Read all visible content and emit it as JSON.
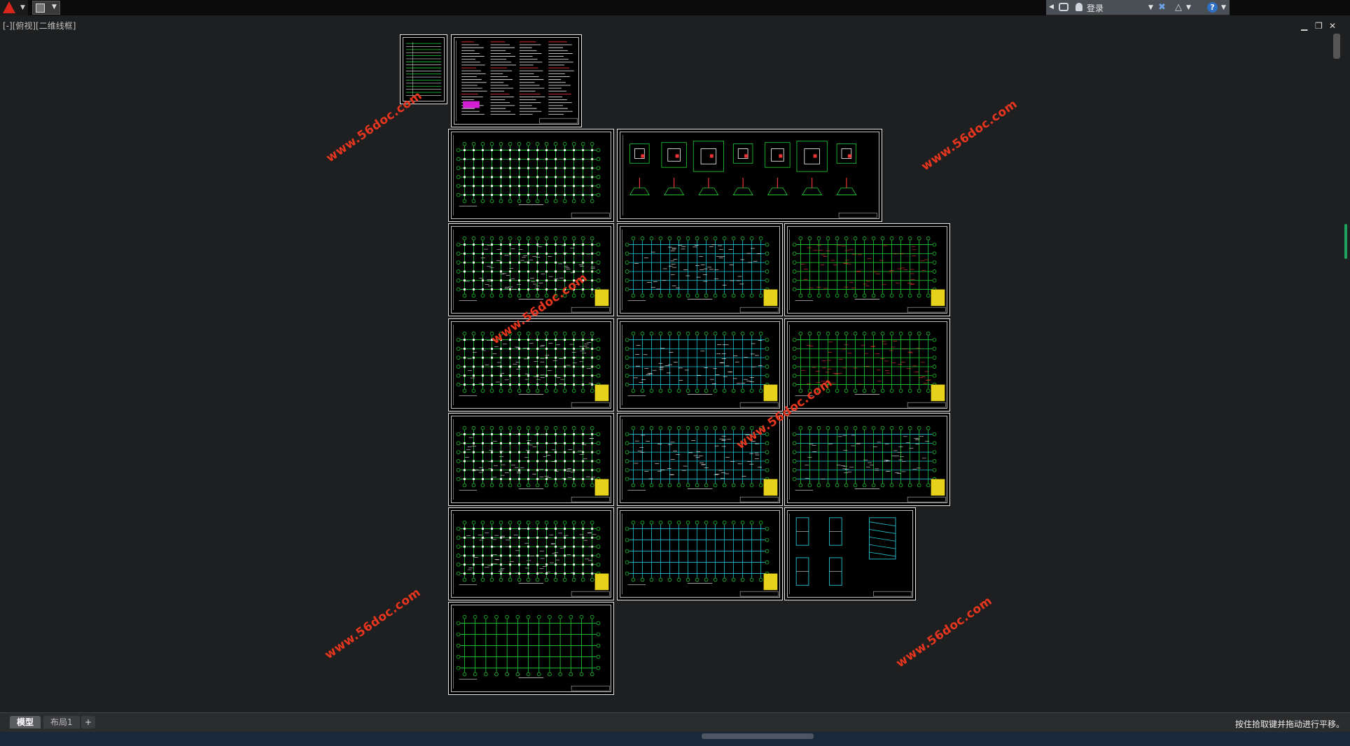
{
  "topbar": {
    "login_label": "登录"
  },
  "viewport": {
    "view_label": "[-][俯视][二维线框]"
  },
  "watermark_text": "www.56doc.com",
  "layout_tabs": {
    "model": "模型",
    "layout1": "布局1",
    "add": "+"
  },
  "status": {
    "message": "按住拾取键并拖动进行平移。"
  },
  "colors": {
    "background": "#1e1f20",
    "grid_green": "#22d633",
    "beam_cyan": "#22c7d6",
    "watermark_red": "#e8361e"
  }
}
